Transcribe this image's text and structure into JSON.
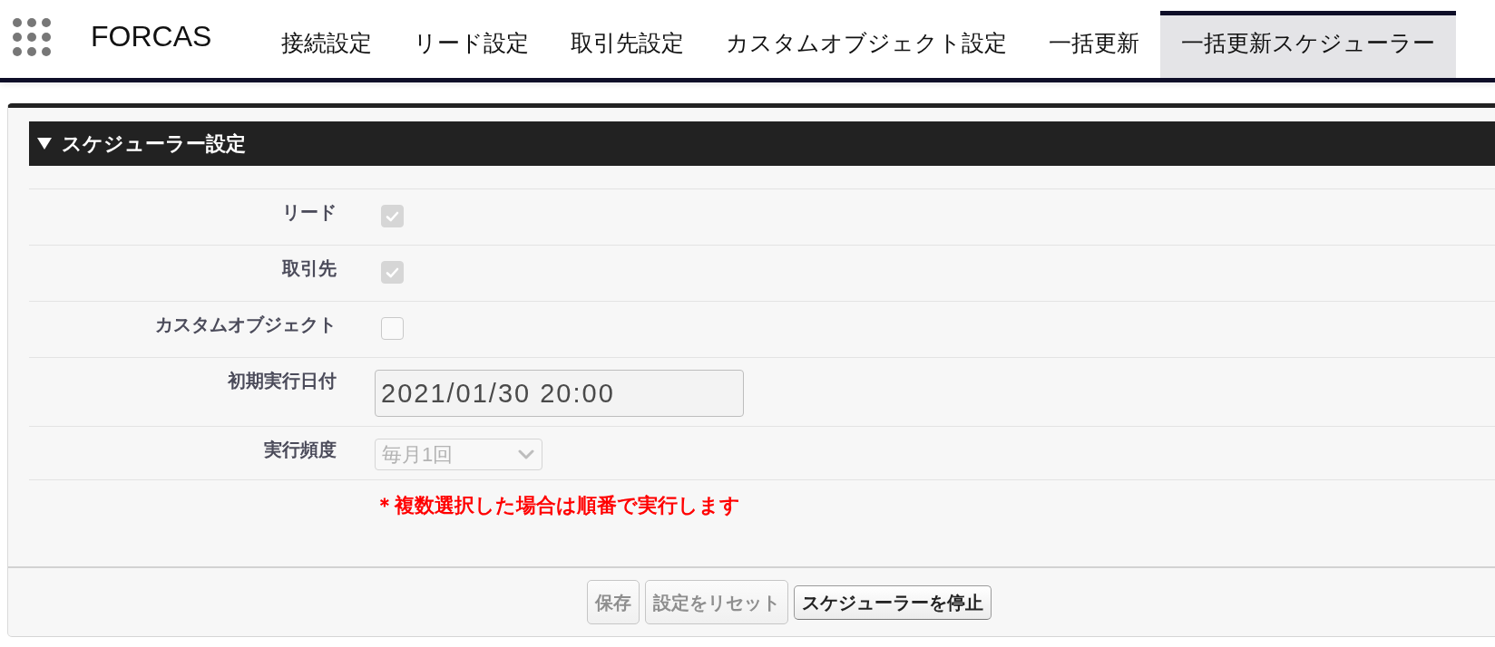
{
  "nav": {
    "app_name": "FORCAS",
    "tabs": [
      {
        "label": "接続設定",
        "selected": false
      },
      {
        "label": "リード設定",
        "selected": false
      },
      {
        "label": "取引先設定",
        "selected": false
      },
      {
        "label": "カスタムオブジェクト設定",
        "selected": false
      },
      {
        "label": "一括更新",
        "selected": false
      },
      {
        "label": "一括更新スケジューラー",
        "selected": true
      }
    ]
  },
  "panel": {
    "section_title": "スケジューラー設定",
    "expanded": true,
    "fields": [
      {
        "kind": "checkbox",
        "label": "リード",
        "checked": true,
        "disabled": true
      },
      {
        "kind": "checkbox",
        "label": "取引先",
        "checked": true,
        "disabled": true
      },
      {
        "kind": "checkbox",
        "label": "カスタムオブジェクト",
        "checked": false,
        "disabled": false
      },
      {
        "kind": "text",
        "label": "初期実行日付",
        "value": "2021/01/30 20:00"
      },
      {
        "kind": "select",
        "label": "実行頻度",
        "value": "毎月1回",
        "disabled": true
      }
    ],
    "note": "＊複数選択した場合は順番で実行します",
    "buttons": [
      {
        "label": "保存",
        "disabled": true
      },
      {
        "label": "設定をリセット",
        "disabled": true
      },
      {
        "label": "スケジューラーを停止",
        "disabled": false
      }
    ]
  }
}
